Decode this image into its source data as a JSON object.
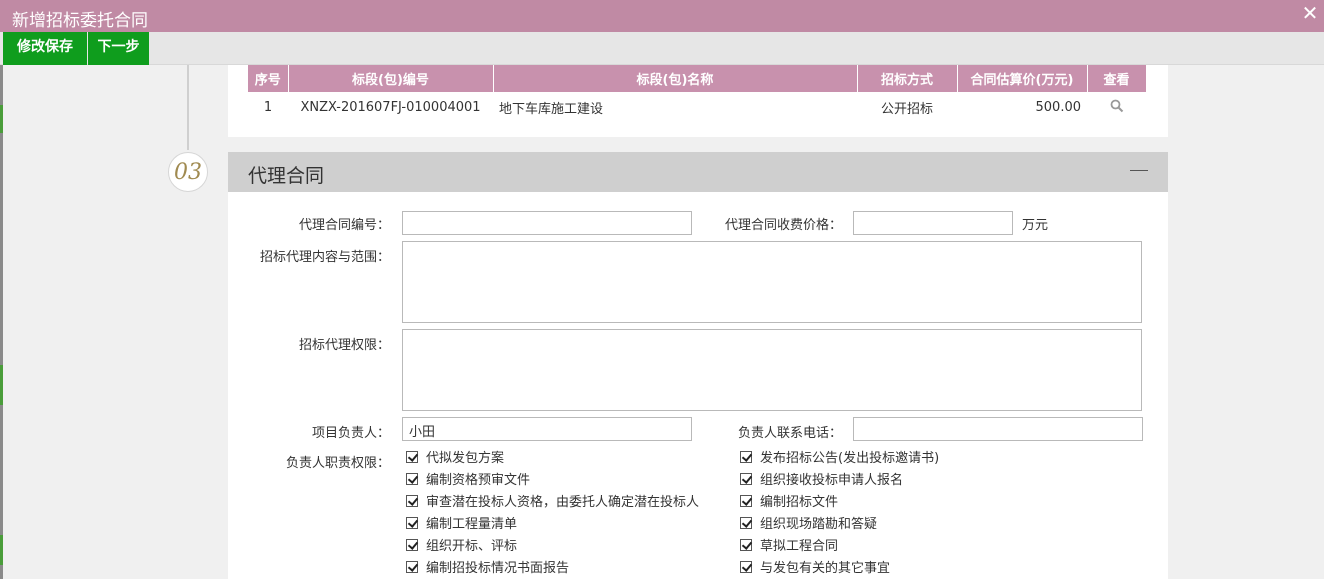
{
  "window": {
    "title": "新增招标委托合同",
    "close_icon": "close-icon"
  },
  "toolbar": {
    "save_label": "修改保存",
    "next_label": "下一步"
  },
  "bid_table": {
    "headers": [
      "序号",
      "标段(包)编号",
      "标段(包)名称",
      "招标方式",
      "合同估算价(万元)",
      "查看"
    ],
    "rows": [
      {
        "index": "1",
        "code": "XNZX-201607FJ-010004001",
        "name": "地下车库施工建设",
        "method": "公开招标",
        "price": "500.00",
        "view_icon": "search-icon"
      }
    ]
  },
  "section": {
    "step": "03",
    "title": "代理合同",
    "collapse_icon": "minus-icon"
  },
  "form": {
    "contract_no_label": "代理合同编号：",
    "contract_no_value": "",
    "fee_label": "代理合同收费价格：",
    "fee_value": "",
    "fee_unit": "万元",
    "scope_label": "招标代理内容与范围：",
    "authority_label": "招标代理权限：",
    "manager_label": "项目负责人：",
    "manager_value": "小田",
    "phone_label": "负责人联系电话：",
    "phone_value": "",
    "duties_label": "负责人职责权限：",
    "duties_left": [
      "代拟发包方案",
      "编制资格预审文件",
      "审查潜在投标人资格，由委托人确定潜在投标人",
      "编制工程量清单",
      "组织开标、评标",
      "编制招投标情况书面报告"
    ],
    "duties_right": [
      "发布招标公告(发出投标邀请书)",
      "组织接收投标申请人报名",
      "编制招标文件",
      "组织现场踏勘和答疑",
      "草拟工程合同",
      "与发包有关的其它事宜"
    ]
  }
}
